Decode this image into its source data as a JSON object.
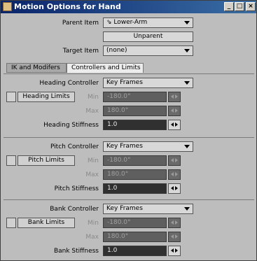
{
  "window": {
    "title": "Motion Options for Hand",
    "controls": [
      "_",
      "□",
      "×"
    ]
  },
  "parent": {
    "label": "Parent Item",
    "value": "⇘ Lower-Arm",
    "unparent_label": "Unparent"
  },
  "target": {
    "label": "Target Item",
    "value": "(none)"
  },
  "tabs": [
    {
      "label": "IK and Modifers",
      "active": false
    },
    {
      "label": "Controllers and Limits",
      "active": true
    }
  ],
  "sections": [
    {
      "controller_label": "Heading Controller",
      "controller_value": "Key Frames",
      "limits_label": "Heading Limits",
      "min_label": "Min",
      "min_value": "-180.0°",
      "max_label": "Max",
      "max_value": "180.0°",
      "stiffness_label": "Heading Stiffness",
      "stiffness_value": "1.0"
    },
    {
      "controller_label": "Pitch Controller",
      "controller_value": "Key Frames",
      "limits_label": "Pitch Limits",
      "min_label": "Min",
      "min_value": "-180.0°",
      "max_label": "Max",
      "max_value": "180.0°",
      "stiffness_label": "Pitch Stiffness",
      "stiffness_value": "1.0"
    },
    {
      "controller_label": "Bank Controller",
      "controller_value": "Key Frames",
      "limits_label": "Bank Limits",
      "min_label": "Min",
      "min_value": "-180.0°",
      "max_label": "Max",
      "max_value": "180.0°",
      "stiffness_label": "Bank Stiffness",
      "stiffness_value": "1.0"
    }
  ]
}
